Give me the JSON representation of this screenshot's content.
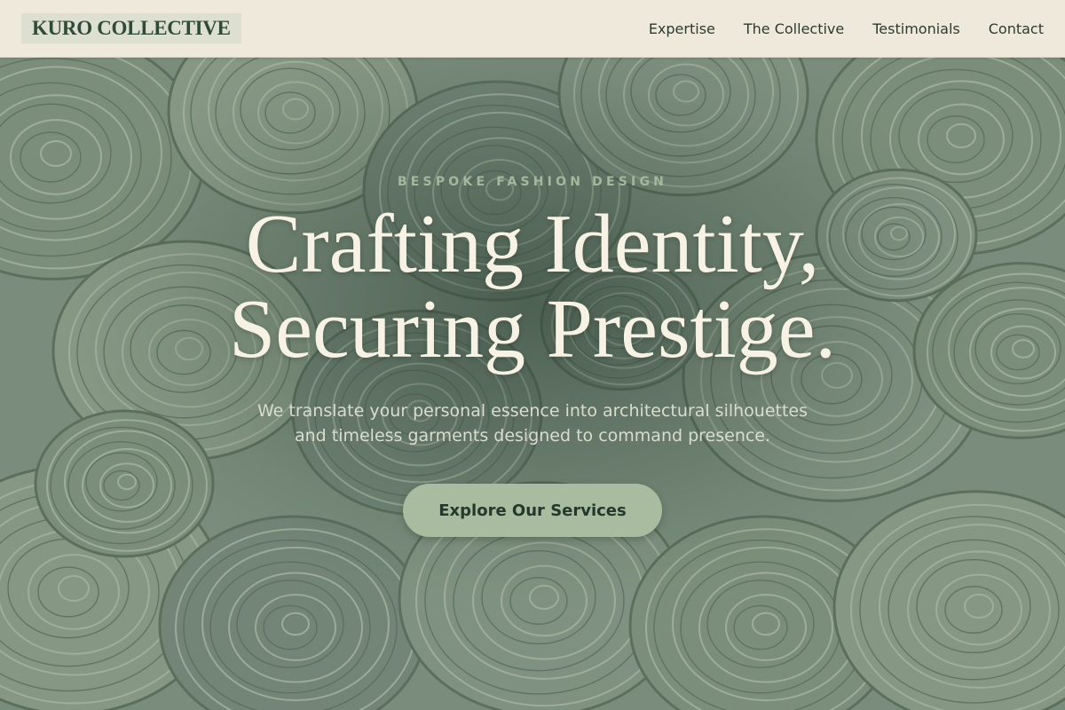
{
  "header": {
    "logo_text": "KURO COLLECTIVE",
    "nav": [
      {
        "label": "Expertise"
      },
      {
        "label": "The Collective"
      },
      {
        "label": "Testimonials"
      },
      {
        "label": "Contact"
      }
    ]
  },
  "hero": {
    "background_icon": "fabric-rolls-photo",
    "eyebrow": "BESPOKE FASHION DESIGN",
    "headline_line1": "Crafting Identity,",
    "headline_line2": "Securing Prestige.",
    "subtitle_line1": "We translate your personal essence into architectural silhouettes",
    "subtitle_line2": "and timeless garments designed to command presence.",
    "cta_label": "Explore Our Services"
  },
  "colors": {
    "header_bg": "#efe9dc",
    "logo_bg": "#dde0d1",
    "logo_text": "#2f4a38",
    "hero_tint": "#6f8672",
    "headline": "#f8f2e5",
    "eyebrow": "#a3b89c",
    "cta_bg": "#a9bc9f",
    "cta_text": "#24382b"
  }
}
